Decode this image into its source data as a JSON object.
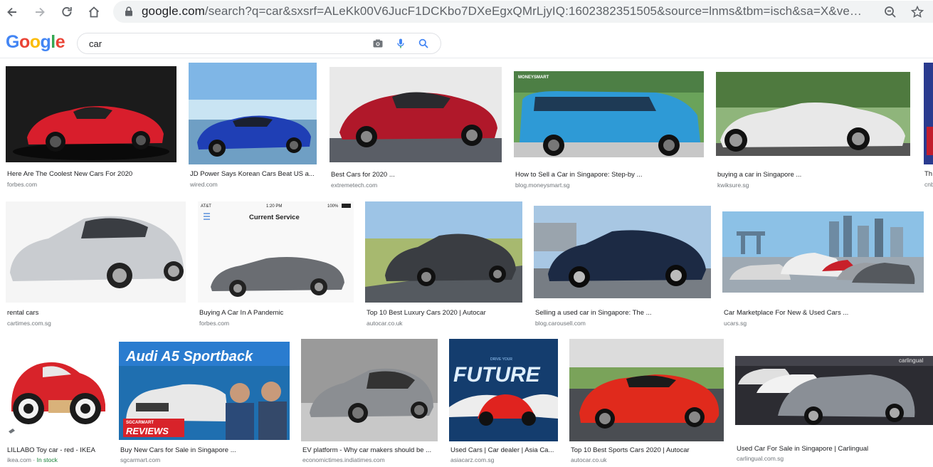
{
  "browser": {
    "url_domain": "google.com",
    "url_path": "/search?q=car&sxsrf=ALeKk00V6JucF1DCKbo7DXeEgxQMrLjyIQ:1602382351505&source=lnms&tbm=isch&sa=X&ved=2ah...",
    "icons": [
      "back-icon",
      "forward-icon",
      "reload-icon",
      "home-icon",
      "lock-icon",
      "zoom-icon",
      "star-icon"
    ]
  },
  "google": {
    "logo": [
      "G",
      "o",
      "o",
      "g",
      "l",
      "e"
    ],
    "logo_colors": [
      "#4285f4",
      "#ea4335",
      "#fbbc05",
      "#4285f4",
      "#34a853",
      "#ea4335"
    ],
    "query": "car",
    "icons": [
      "camera-icon",
      "microphone-icon",
      "search-icon"
    ]
  },
  "results": [
    {
      "title": "Here Are The Coolest New Cars For 2020",
      "source": "forbes.com"
    },
    {
      "title": "JD Power Says Korean Cars Beat US a...",
      "source": "wired.com"
    },
    {
      "title": "Best Cars for 2020 ...",
      "source": "extremetech.com"
    },
    {
      "title": "How to Sell a Car in Singapore: Step-by ...",
      "source": "blog.moneysmart.sg",
      "overlay": "MONEYSMART"
    },
    {
      "title": "buying a car in Singapore ...",
      "source": "kwiksure.sg"
    },
    {
      "title": "Th",
      "source": "cnb"
    },
    {
      "title": "rental cars",
      "source": "cartimes.com.sg"
    },
    {
      "title": "Buying A Car In A Pandemic",
      "source": "forbes.com",
      "overlay_title": "Current Service",
      "overlay_status": "AT&T",
      "overlay_time": "1:20 PM",
      "overlay_battery": "100%"
    },
    {
      "title": "Top 10 Best Luxury Cars 2020 | Autocar",
      "source": "autocar.co.uk"
    },
    {
      "title": "Selling a used car in Singapore: The ...",
      "source": "blog.carousell.com"
    },
    {
      "title": "Car Marketplace For New & Used Cars ...",
      "source": "ucars.sg"
    },
    {
      "title": "LILLABO Toy car - red - IKEA",
      "source": "ikea.com",
      "stock": "In stock"
    },
    {
      "title": "Buy New Cars for Sale in Singapore ...",
      "source": "sgcarmart.com",
      "overlay": "Audi A5 Sportback",
      "overlay_brand": "SGCARMART",
      "overlay_tag": "REVIEWS"
    },
    {
      "title": "EV platform - Why car makers should be ...",
      "source": "economictimes.indiatimes.com"
    },
    {
      "title": "Used Cars | Car dealer | Asia Ca...",
      "source": "asiacarz.com.sg",
      "overlay": "FUTURE",
      "overlay_top": "DRIVE YOUR"
    },
    {
      "title": "Top 10 Best Sports Cars 2020 | Autocar",
      "source": "autocar.co.uk"
    },
    {
      "title": "Used Car For Sale in Singapore | Carlingual",
      "source": "carlingual.com.sg",
      "overlay": "carlingual"
    }
  ],
  "colors": {
    "thumbs": [
      {
        "bg": "#1b1b1b",
        "car": "#d81e2c"
      },
      {
        "bg": "#7fb6e6",
        "car": "#1f3fb5"
      },
      {
        "bg": "#e9e9e9",
        "car": "#b0182a"
      },
      {
        "bg": "#6aa35a",
        "car": "#2e9ad6"
      },
      {
        "bg": "#8fb57b",
        "car": "#e8e8e8"
      },
      {
        "bg": "#2a3b8f",
        "car": "#c21e2e"
      },
      {
        "bg": "#f5f5f5",
        "car": "#c9ccd0"
      },
      {
        "bg": "#f8f8f8",
        "car": "#6a6d72"
      },
      {
        "bg": "#a7b96f",
        "car": "#3a3d42"
      },
      {
        "bg": "#a8c7e3",
        "car": "#1c2a44"
      },
      {
        "bg": "#8cc1e6",
        "car": "#d8d8d8"
      },
      {
        "bg": "#ffffff",
        "car": "#d8232a"
      },
      {
        "bg": "#1f6fb0",
        "car": "#e8e8e8"
      },
      {
        "bg": "#9a9a9a",
        "car": "#8b8e92"
      },
      {
        "bg": "#143d6e",
        "car": "#e0231f"
      },
      {
        "bg": "#dcdcdc",
        "car": "#e02a1c"
      },
      {
        "bg": "#2c2c32",
        "car": "#8a8f96"
      }
    ]
  }
}
